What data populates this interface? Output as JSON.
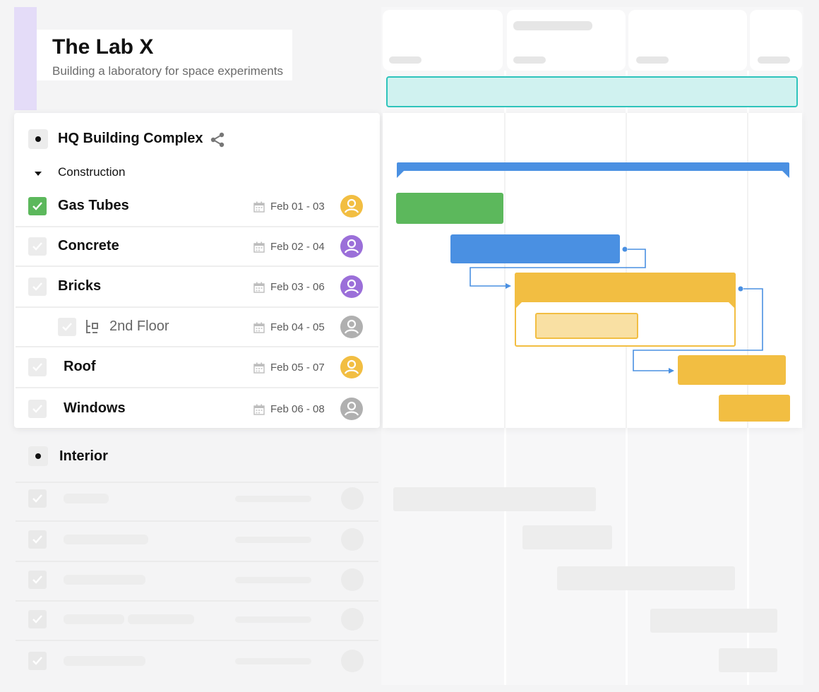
{
  "project": {
    "title": "The Lab X",
    "subtitle": "Building a laboratory for space experiments"
  },
  "group": {
    "title": "HQ Building Complex",
    "icon": "share-icon"
  },
  "section": {
    "title": "Construction",
    "icon": "caret-down-icon"
  },
  "tasks": [
    {
      "name": "Gas Tubes",
      "date": "Feb 01 - 03",
      "done": true,
      "avatar_color": "#f2be42"
    },
    {
      "name": "Concrete",
      "date": "Feb 02 - 04",
      "done": false,
      "avatar_color": "#9b6fd9"
    },
    {
      "name": "Bricks",
      "date": "Feb 03 - 06",
      "done": false,
      "avatar_color": "#9b6fd9"
    },
    {
      "name": "2nd Floor",
      "date": "Feb 04 - 05",
      "done": false,
      "avatar_color": "#b0b0b0",
      "subtask": true
    },
    {
      "name": "Roof",
      "date": "Feb 05 - 07",
      "done": false,
      "avatar_color": "#f2be42"
    },
    {
      "name": "Windows",
      "date": "Feb 06 - 08",
      "done": false,
      "avatar_color": "#b0b0b0"
    }
  ],
  "group2": {
    "title": "Interior"
  },
  "colors": {
    "summary_teal": "#2ec4bc",
    "group_blue": "#4a90e2",
    "done_green": "#5cb85c",
    "task_yellow": "#f2be42",
    "light_yellow": "#f9e0a3",
    "accent_lavender": "#e4dcf8"
  }
}
